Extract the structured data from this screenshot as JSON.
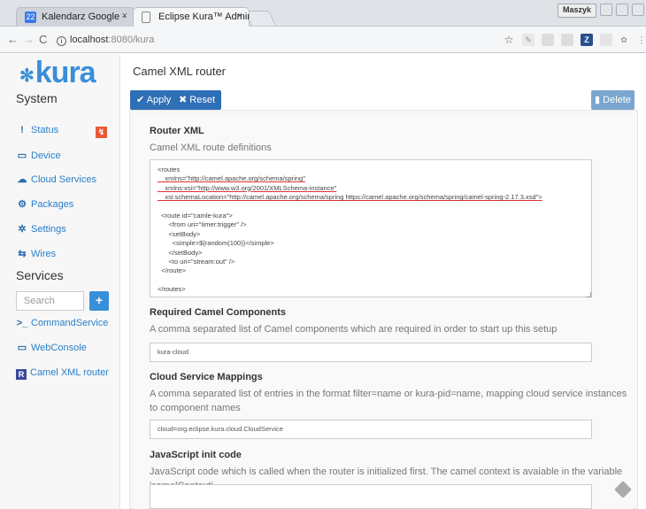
{
  "browser": {
    "tabs": [
      {
        "label": "Kalendarz Google -",
        "icon": "calendar-icon",
        "icon_text": "22"
      },
      {
        "label": "Eclipse Kura™ Admin",
        "icon": "document-icon"
      }
    ],
    "user_button": "Maszyk",
    "url_host": "localhost",
    "url_path": ":8080/kura"
  },
  "sidebar": {
    "logo_text": "kura",
    "system_title": "System",
    "system_items": [
      {
        "label": "Status",
        "icon": "!"
      },
      {
        "label": "Device",
        "icon": "▭"
      },
      {
        "label": "Cloud Services",
        "icon": "☁"
      },
      {
        "label": "Packages",
        "icon": "⚙"
      },
      {
        "label": "Settings",
        "icon": "✲"
      },
      {
        "label": "Wires",
        "icon": "⇆"
      }
    ],
    "services_title": "Services",
    "search_placeholder": "Search",
    "add_label": "+",
    "service_items": [
      {
        "label": "CommandService",
        "icon": ">_"
      },
      {
        "label": "WebConsole",
        "icon": "▭"
      },
      {
        "label": "Camel XML router",
        "icon": "R"
      }
    ]
  },
  "main": {
    "title": "Camel XML router",
    "apply_label": "Apply",
    "reset_label": "Reset",
    "delete_label": "Delete",
    "fields": [
      {
        "label": "Router XML",
        "desc": "Camel XML route definitions"
      },
      {
        "label": "Required Camel Components",
        "desc": "A comma separated list of Camel components which are required in order to start up this setup",
        "value": "kura-cloud"
      },
      {
        "label": "Cloud Service Mappings",
        "desc": "A comma separated list of entries in the format filter=name or kura-pid=name, mapping cloud service instances to component names",
        "value": "cloud=org.eclipse.kura.cloud.CloudService"
      },
      {
        "label": "JavaScript init code",
        "desc": "JavaScript code which is called when the router is initialized first. The camel context is avaiable in the variable 'camelContext'.",
        "value": ""
      }
    ],
    "xml_lines": [
      "<routes",
      "    xmlns=\"http://camel.apache.org/schema/spring\"",
      "    xmlns:xsi=\"http://www.w3.org/2001/XMLSchema-instance\"",
      "    xsi:schemaLocation=\"http://camel.apache.org/schema/spring https://camel.apache.org/schema/spring/camel-spring-2.17.3.xsd\">",
      "",
      "  <route id=\"camle-kura\">",
      "      <from uri=\"timer:trigger\" />",
      "      <setBody>",
      "        <simple>${random(100)}</simple>",
      "      </setBody>",
      "      <to uri=\"stream:out\" />",
      "  </route>",
      "",
      "</routes>"
    ]
  }
}
